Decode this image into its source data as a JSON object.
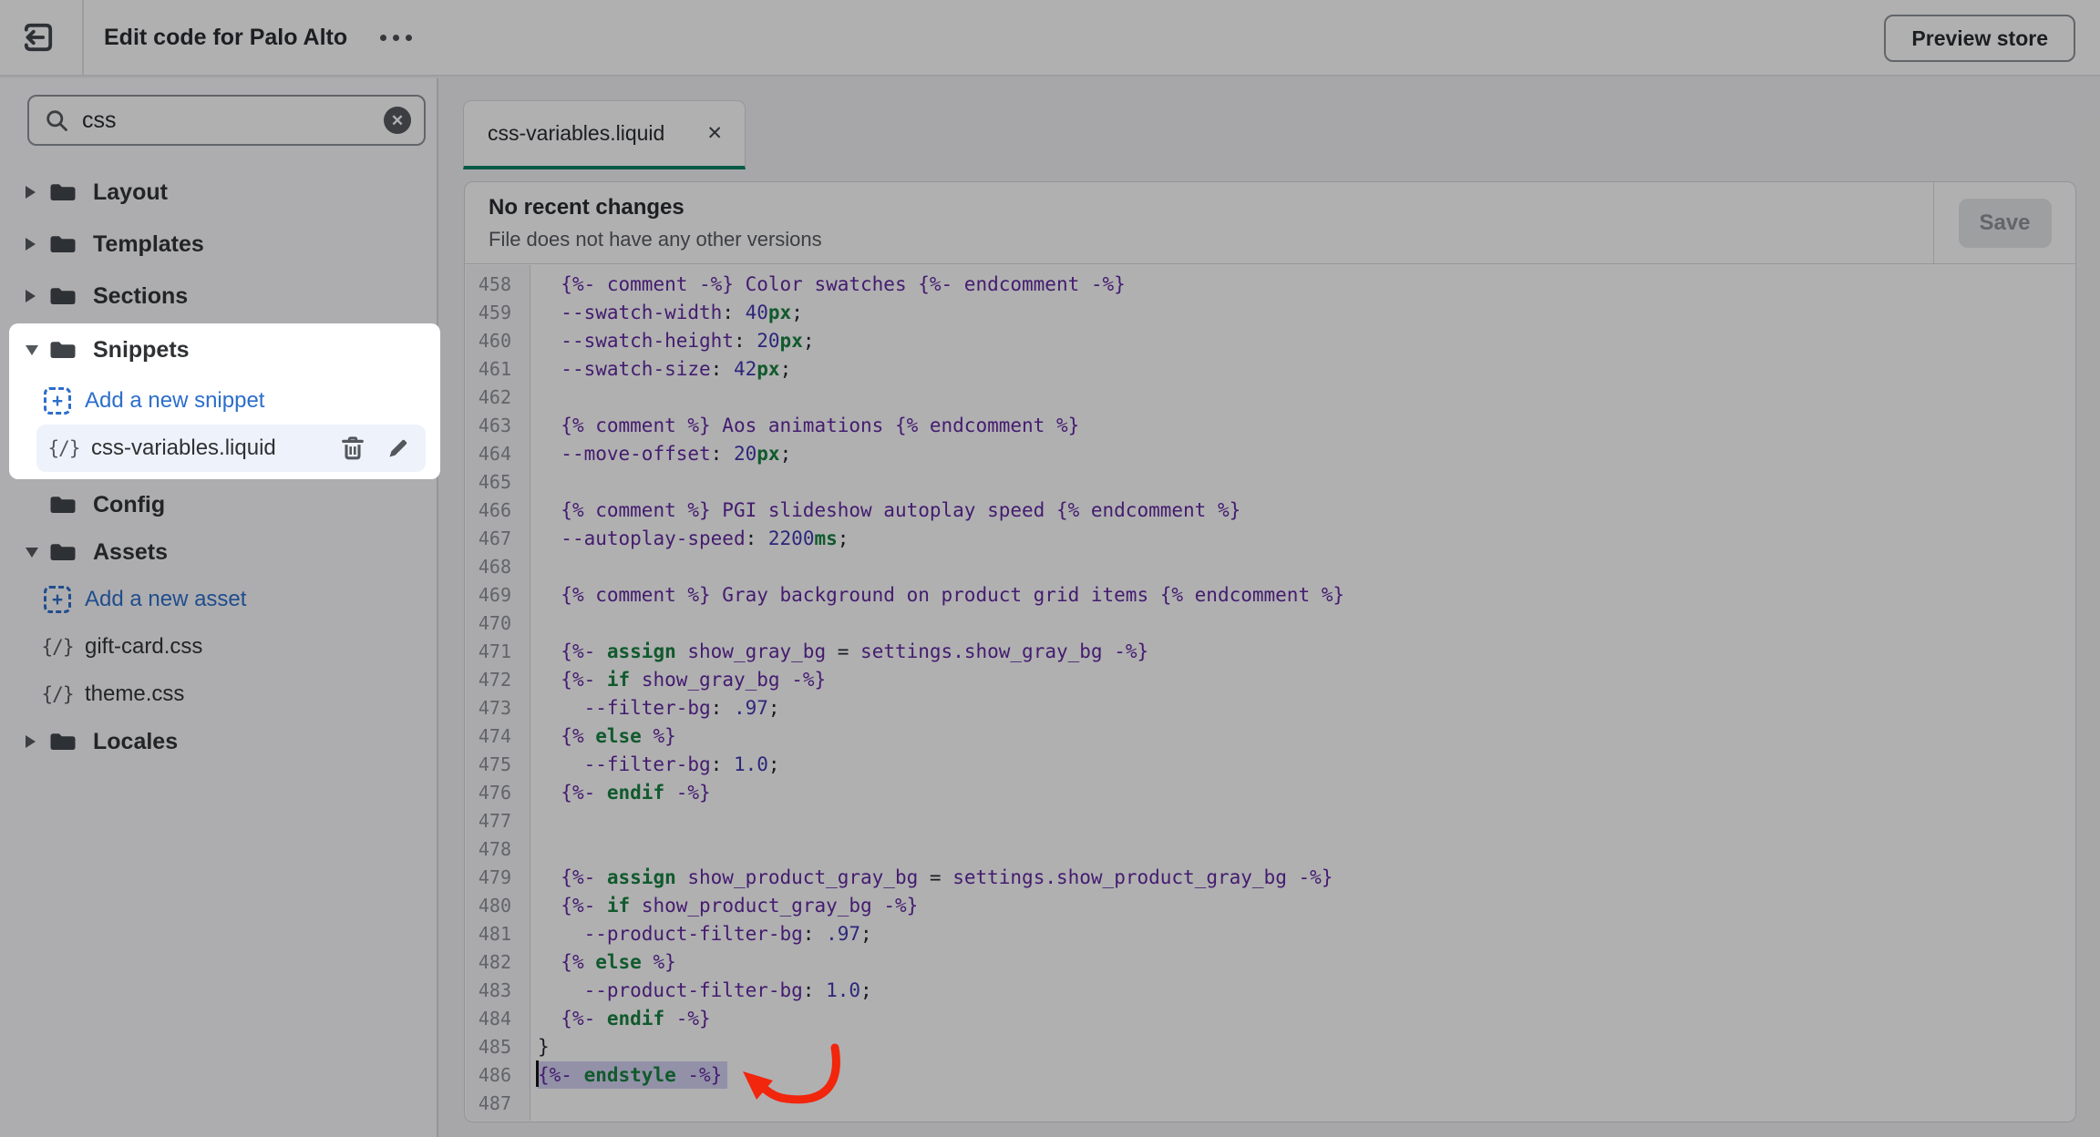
{
  "topbar": {
    "title": "Edit code for Palo Alto",
    "preview_button_label": "Preview store"
  },
  "sidebar": {
    "search": {
      "value": "css",
      "clear_icon": "circle-x-icon"
    },
    "file_icon_glyph": "{/}",
    "tree": [
      {
        "label": "Layout",
        "kind": "folder",
        "caret": "collapsed"
      },
      {
        "label": "Templates",
        "kind": "folder",
        "caret": "collapsed"
      },
      {
        "label": "Sections",
        "kind": "folder",
        "caret": "collapsed"
      },
      {
        "label": "Snippets",
        "kind": "folder",
        "caret": "expanded",
        "spotlight": true
      },
      {
        "label": "Add a new snippet",
        "kind": "add-link",
        "spotlight": true
      },
      {
        "label": "css-variables.liquid",
        "kind": "file",
        "selected": true,
        "actions": [
          "trash-icon",
          "pencil-icon"
        ],
        "spotlight": true
      },
      {
        "label": "Config",
        "kind": "folder",
        "caret": "none"
      },
      {
        "label": "Assets",
        "kind": "folder",
        "caret": "expanded"
      },
      {
        "label": "Add a new asset",
        "kind": "add-link"
      },
      {
        "label": "gift-card.css",
        "kind": "file"
      },
      {
        "label": "theme.css",
        "kind": "file"
      },
      {
        "label": "Locales",
        "kind": "folder",
        "caret": "collapsed"
      }
    ]
  },
  "editor": {
    "tab_label": "css-variables.liquid",
    "header_title": "No recent changes",
    "header_subtitle": "File does not have any other versions",
    "save_label": "Save",
    "lines": [
      {
        "no": 458,
        "tokens": [
          [
            "plain",
            "  "
          ],
          [
            "liq",
            "{%- comment -%} Color swatches {%- endcomment -%}"
          ]
        ]
      },
      {
        "no": 459,
        "tokens": [
          [
            "plain",
            "  "
          ],
          [
            "prop",
            "--swatch-width"
          ],
          [
            "pun",
            ": "
          ],
          [
            "num",
            "40"
          ],
          [
            "unit",
            "px"
          ],
          [
            "pun",
            ";"
          ]
        ]
      },
      {
        "no": 460,
        "tokens": [
          [
            "plain",
            "  "
          ],
          [
            "prop",
            "--swatch-height"
          ],
          [
            "pun",
            ": "
          ],
          [
            "num",
            "20"
          ],
          [
            "unit",
            "px"
          ],
          [
            "pun",
            ";"
          ]
        ]
      },
      {
        "no": 461,
        "tokens": [
          [
            "plain",
            "  "
          ],
          [
            "prop",
            "--swatch-size"
          ],
          [
            "pun",
            ": "
          ],
          [
            "num",
            "42"
          ],
          [
            "unit",
            "px"
          ],
          [
            "pun",
            ";"
          ]
        ]
      },
      {
        "no": 462,
        "tokens": []
      },
      {
        "no": 463,
        "tokens": [
          [
            "plain",
            "  "
          ],
          [
            "liq",
            "{% comment %} Aos animations {% endcomment %}"
          ]
        ]
      },
      {
        "no": 464,
        "tokens": [
          [
            "plain",
            "  "
          ],
          [
            "prop",
            "--move-offset"
          ],
          [
            "pun",
            ": "
          ],
          [
            "num",
            "20"
          ],
          [
            "unit",
            "px"
          ],
          [
            "pun",
            ";"
          ]
        ]
      },
      {
        "no": 465,
        "tokens": []
      },
      {
        "no": 466,
        "tokens": [
          [
            "plain",
            "  "
          ],
          [
            "liq",
            "{% comment %} PGI slideshow autoplay speed {% endcomment %}"
          ]
        ]
      },
      {
        "no": 467,
        "tokens": [
          [
            "plain",
            "  "
          ],
          [
            "prop",
            "--autoplay-speed"
          ],
          [
            "pun",
            ": "
          ],
          [
            "num",
            "2200"
          ],
          [
            "unit",
            "ms"
          ],
          [
            "pun",
            ";"
          ]
        ]
      },
      {
        "no": 468,
        "tokens": []
      },
      {
        "no": 469,
        "tokens": [
          [
            "plain",
            "  "
          ],
          [
            "liq",
            "{% comment %} Gray background on product grid items {% endcomment %}"
          ]
        ]
      },
      {
        "no": 470,
        "tokens": []
      },
      {
        "no": 471,
        "tokens": [
          [
            "plain",
            "  "
          ],
          [
            "liq",
            "{%- "
          ],
          [
            "kw",
            "assign"
          ],
          [
            "var",
            " show_gray_bg "
          ],
          [
            "pun",
            "="
          ],
          [
            "var",
            " settings.show_gray_bg "
          ],
          [
            "liq",
            "-%}"
          ]
        ]
      },
      {
        "no": 472,
        "tokens": [
          [
            "plain",
            "  "
          ],
          [
            "liq",
            "{%- "
          ],
          [
            "kw",
            "if"
          ],
          [
            "var",
            " show_gray_bg "
          ],
          [
            "liq",
            "-%}"
          ]
        ]
      },
      {
        "no": 473,
        "tokens": [
          [
            "plain",
            "    "
          ],
          [
            "prop",
            "--filter-bg"
          ],
          [
            "pun",
            ": "
          ],
          [
            "num",
            ".97"
          ],
          [
            "pun",
            ";"
          ]
        ]
      },
      {
        "no": 474,
        "tokens": [
          [
            "plain",
            "  "
          ],
          [
            "liq",
            "{% "
          ],
          [
            "kw",
            "else"
          ],
          [
            "liq",
            " %}"
          ]
        ]
      },
      {
        "no": 475,
        "tokens": [
          [
            "plain",
            "    "
          ],
          [
            "prop",
            "--filter-bg"
          ],
          [
            "pun",
            ": "
          ],
          [
            "num",
            "1.0"
          ],
          [
            "pun",
            ";"
          ]
        ]
      },
      {
        "no": 476,
        "tokens": [
          [
            "plain",
            "  "
          ],
          [
            "liq",
            "{%- "
          ],
          [
            "kw",
            "endif"
          ],
          [
            "liq",
            " -%}"
          ]
        ]
      },
      {
        "no": 477,
        "tokens": []
      },
      {
        "no": 478,
        "tokens": []
      },
      {
        "no": 479,
        "tokens": [
          [
            "plain",
            "  "
          ],
          [
            "liq",
            "{%- "
          ],
          [
            "kw",
            "assign"
          ],
          [
            "var",
            " show_product_gray_bg "
          ],
          [
            "pun",
            "="
          ],
          [
            "var",
            " settings.show_product_gray_bg "
          ],
          [
            "liq",
            "-%}"
          ]
        ]
      },
      {
        "no": 480,
        "tokens": [
          [
            "plain",
            "  "
          ],
          [
            "liq",
            "{%- "
          ],
          [
            "kw",
            "if"
          ],
          [
            "var",
            " show_product_gray_bg "
          ],
          [
            "liq",
            "-%}"
          ]
        ]
      },
      {
        "no": 481,
        "tokens": [
          [
            "plain",
            "    "
          ],
          [
            "prop",
            "--product-filter-bg"
          ],
          [
            "pun",
            ": "
          ],
          [
            "num",
            ".97"
          ],
          [
            "pun",
            ";"
          ]
        ]
      },
      {
        "no": 482,
        "tokens": [
          [
            "plain",
            "  "
          ],
          [
            "liq",
            "{% "
          ],
          [
            "kw",
            "else"
          ],
          [
            "liq",
            " %}"
          ]
        ]
      },
      {
        "no": 483,
        "tokens": [
          [
            "plain",
            "    "
          ],
          [
            "prop",
            "--product-filter-bg"
          ],
          [
            "pun",
            ": "
          ],
          [
            "num",
            "1.0"
          ],
          [
            "pun",
            ";"
          ]
        ]
      },
      {
        "no": 484,
        "tokens": [
          [
            "plain",
            "  "
          ],
          [
            "liq",
            "{%- "
          ],
          [
            "kw",
            "endif"
          ],
          [
            "liq",
            " -%}"
          ]
        ]
      },
      {
        "no": 485,
        "tokens": [
          [
            "pun",
            "}"
          ]
        ]
      },
      {
        "no": 486,
        "selected": true,
        "cursor": true,
        "tokens": [
          [
            "liq",
            "{%- "
          ],
          [
            "kw",
            "endstyle"
          ],
          [
            "liq",
            " -%}"
          ]
        ]
      },
      {
        "no": 487,
        "tokens": []
      }
    ]
  },
  "annotation": {
    "shape": "curved-arrow",
    "color": "#f2250d",
    "points_at_line": 486
  },
  "theme": {
    "accent_green": "#008060",
    "link_blue": "#2c6ecb",
    "selection_purple": "#d3d2f1",
    "liquid_purple": "#61259e",
    "keyword_green": "#15803d",
    "number_indigo": "#3d35b0",
    "annotation_red": "#f2250d"
  }
}
